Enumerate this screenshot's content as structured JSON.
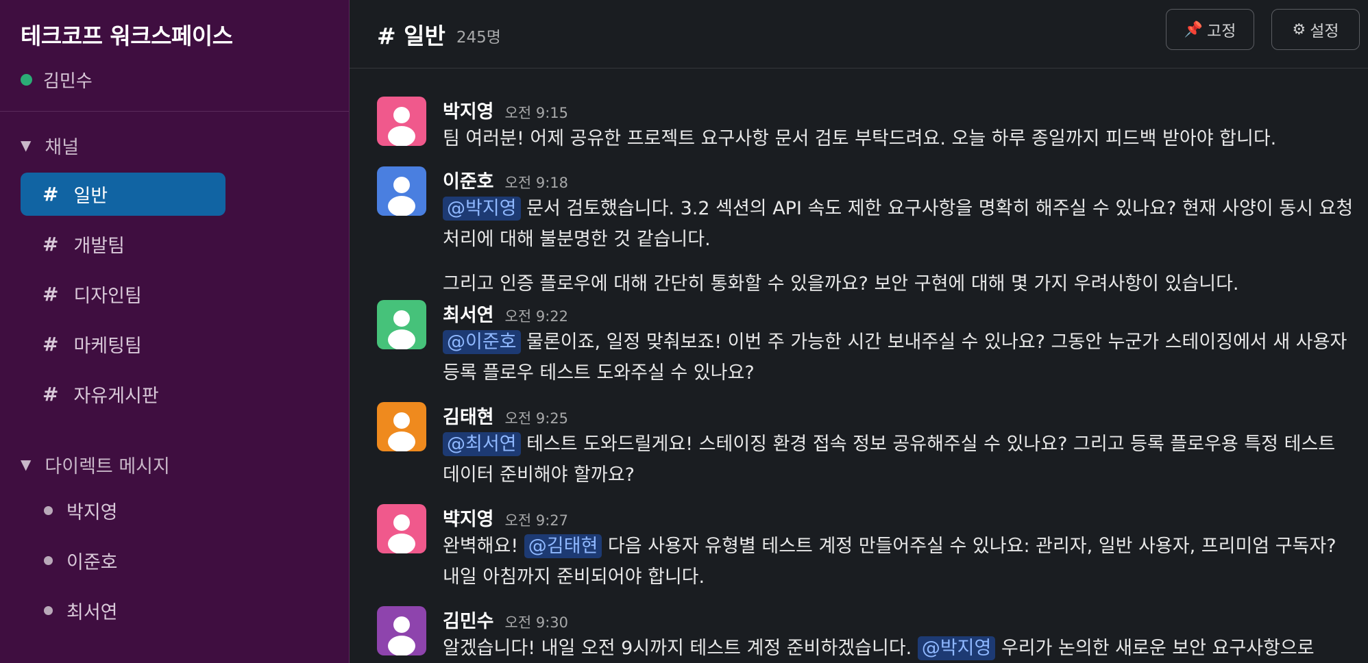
{
  "workspace": {
    "name": "테크코프 워크스페이스",
    "user": "김민수"
  },
  "sidebar": {
    "channels_title": "채널",
    "channels": [
      {
        "hash": "#",
        "label": "일반",
        "active": true
      },
      {
        "hash": "#",
        "label": "개발팀"
      },
      {
        "hash": "#",
        "label": "디자인팀"
      },
      {
        "hash": "#",
        "label": "마케팅팀"
      },
      {
        "hash": "#",
        "label": "자유게시판"
      }
    ],
    "dms_title": "다이렉트 메시지",
    "dms": [
      {
        "label": "박지영"
      },
      {
        "label": "이준호"
      },
      {
        "label": "최서연"
      }
    ]
  },
  "channel": {
    "title": "# 일반",
    "member_count": "245명"
  },
  "toolbar": {
    "pin_icon": "📌",
    "pin_label": "고정",
    "settings_icon": "⚙",
    "settings_label": "설정"
  },
  "colors": {
    "sidebar_bg": "#3f0e40",
    "active_channel": "#1164a3",
    "presence": "#2bac76",
    "avatar_pink": "#f0598c",
    "avatar_blue": "#4a7fe0",
    "avatar_green": "#46c27a",
    "avatar_orange": "#ef8a1e",
    "avatar_purple": "#8e44ad"
  },
  "messages": [
    {
      "author": "박지영",
      "time": "오전 9:15",
      "avatar_color": "#f0598c",
      "mention": "",
      "text": "팀 여러분! 어제 공유한 프로젝트 요구사항 문서 검토 부탁드려요. 오늘 하루 종일까지 피드백 받아야 합니다."
    },
    {
      "author": "이준호",
      "time": "오전 9:18",
      "avatar_color": "#4a7fe0",
      "mention": "@박지영",
      "text": " 문서 검토했습니다. 3.2 섹션의 API 속도 제한 요구사항을 명확히 해주실 수 있나요? 현재 사양이 동시 요청 처리에 대해 불분명한 것 같습니다."
    },
    {
      "continuation": "그리고 인증 플로우에 대해 간단히 통화할 수 있을까요? 보안 구현에 대해 몇 가지 우려사항이 있습니다."
    },
    {
      "author": "최서연",
      "time": "오전 9:22",
      "avatar_color": "#46c27a",
      "mention": "@이준호",
      "text": " 물론이죠, 일정 맞춰보죠! 이번 주 가능한 시간 보내주실 수 있나요? 그동안 누군가 스테이징에서 새 사용자 등록 플로우 테스트 도와주실 수 있나요?"
    },
    {
      "author": "김태현",
      "time": "오전 9:25",
      "avatar_color": "#ef8a1e",
      "mention": "@최서연",
      "text": " 테스트 도와드릴게요! 스테이징 환경 접속 정보 공유해주실 수 있나요? 그리고 등록 플로우용 특정 테스트 데이터 준비해야 할까요?"
    },
    {
      "author": "박지영",
      "time": "오전 9:27",
      "avatar_color": "#f0598c",
      "pre": "완벽해요! ",
      "mention": "@김태현",
      "text": " 다음 사용자 유형별 테스트 계정 만들어주실 수 있나요: 관리자, 일반 사용자, 프리미엄 구독자? 내일 아침까지 준비되어야 합니다."
    },
    {
      "author": "김민수",
      "time": "오전 9:30",
      "avatar_color": "#8e44ad",
      "pre": "알겠습니다! 내일 오전 9시까지 테스트 계정 준비하겠습니다. ",
      "mention": "@박지영",
      "text": " 우리가 논의한 새로운 보안 요구사항으로"
    }
  ]
}
